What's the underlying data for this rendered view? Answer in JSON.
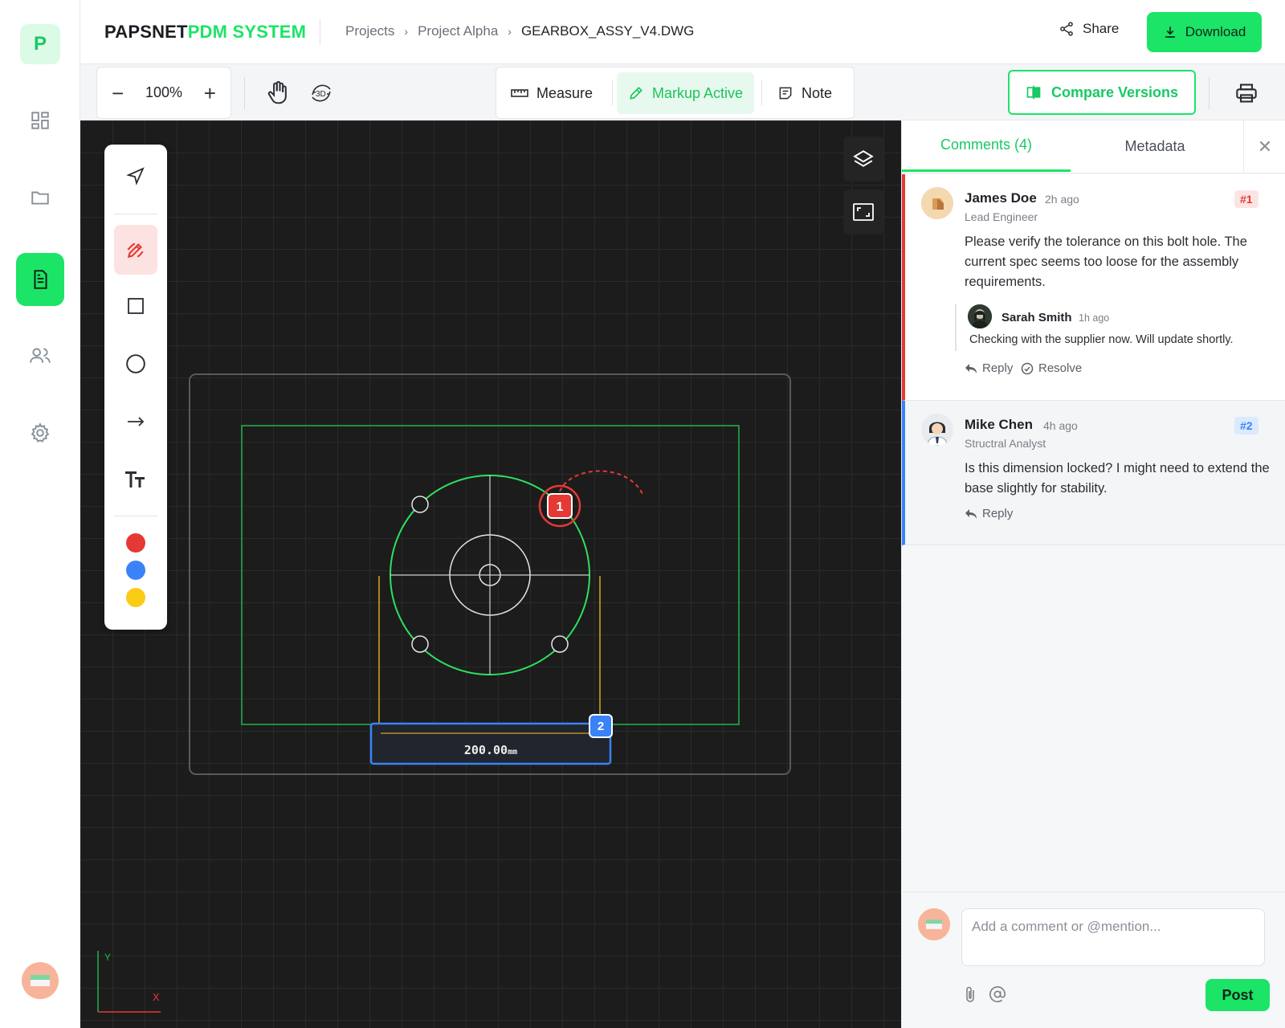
{
  "app": {
    "brand_primary": "PAPSNET",
    "brand_accent": "PDM SYSTEM",
    "accent_color": "#1ce467"
  },
  "rail": {
    "logo_letter": "P",
    "items": [
      {
        "icon": "dashboard-icon"
      },
      {
        "icon": "folder-icon"
      },
      {
        "icon": "document-icon",
        "active": true
      },
      {
        "icon": "users-icon"
      },
      {
        "icon": "gear-icon"
      }
    ]
  },
  "breadcrumb": {
    "items": [
      "Projects",
      "Project Alpha"
    ],
    "current": "GEARBOX_ASSY_V4.DWG"
  },
  "header": {
    "share_label": "Share",
    "download_label": "Download"
  },
  "toolbar": {
    "zoom_level": "100%",
    "zoom_out": "−",
    "zoom_in": "+",
    "rotate_3d_label": "3D",
    "modes": {
      "measure": "Measure",
      "markup": "Markup Active",
      "note": "Note"
    },
    "compare_label": "Compare Versions"
  },
  "canvas": {
    "dimension_label": "200.00",
    "dimension_unit": "mm",
    "markers": {
      "m1": "1",
      "m2": "2"
    },
    "axes": {
      "x": "X",
      "y": "Y"
    },
    "swatches": [
      "#e53935",
      "#3b82f6",
      "#facc15"
    ],
    "tools": [
      "select-icon",
      "pen-markup-icon",
      "rectangle-icon",
      "circle-icon",
      "arrow-icon",
      "text-icon"
    ]
  },
  "panel": {
    "tabs": {
      "comments": "Comments (4)",
      "metadata": "Metadata"
    },
    "comments": [
      {
        "name": "James Doe",
        "time": "2h ago",
        "role": "Lead Engineer",
        "badge": "#1",
        "badge_color": "#e53935",
        "body": "Please verify the tolerance on this bolt hole. The current spec seems too loose for the assembly requirements.",
        "reply": {
          "name": "Sarah Smith",
          "time": "1h ago",
          "body": "Checking with the supplier now. Will update shortly."
        },
        "actions": {
          "reply": "Reply",
          "resolve": "Resolve"
        }
      },
      {
        "name": "Mike Chen",
        "time": "4h ago",
        "role": "Structral Analyst",
        "badge": "#2",
        "badge_color": "#3b82f6",
        "body": "Is this dimension locked? I might need to extend the base slightly for stability.",
        "actions": {
          "reply": "Reply"
        }
      }
    ],
    "composer": {
      "placeholder": "Add a comment or @mention...",
      "post_label": "Post"
    }
  }
}
